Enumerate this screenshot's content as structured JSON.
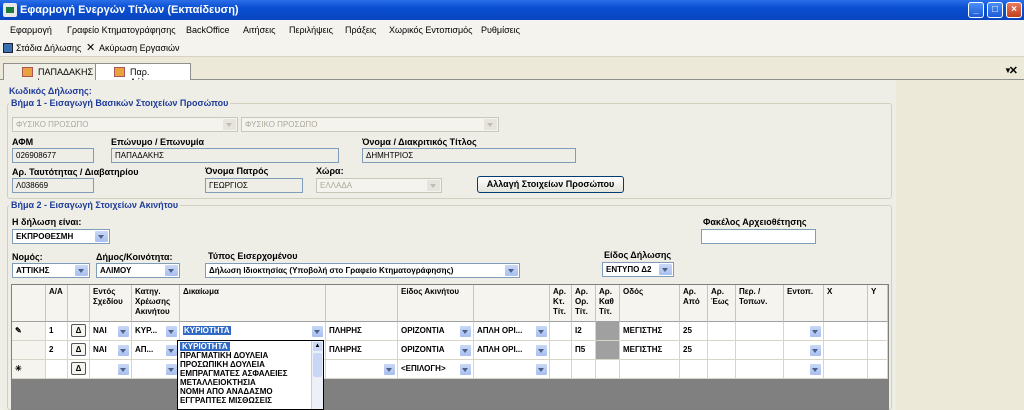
{
  "window": {
    "title": "Εφαρμογή Ενεργών Τίτλων (Εκπαίδευση)"
  },
  "menu": [
    "Εφαρμογή",
    "Γραφείο Κτηματογράφησης",
    "BackOffice",
    "Αιτήσεις",
    "Περιλήψεις",
    "Πράξεις",
    "Χωρικός Εντοπισμός",
    "Ρυθμίσεις"
  ],
  "toolbar": {
    "steps_label": "Στάδια Δήλωσης",
    "cancel_label": "Ακύρωση Εργασιών"
  },
  "tabs": [
    {
      "label": "ΠΑΠΑΔΑΚΗΣ \\"
    },
    {
      "label": "Παρ. Δήλωσης"
    }
  ],
  "form": {
    "code_label": "Κωδικός Δήλωσης:",
    "step1_title": "Βήμα 1 - Εισαγωγή Βασικών Στοιχείων Προσώπου",
    "person_type": "ΦΥΣΙΚΟ ΠΡΟΣΩΠΟ",
    "person_type2": "ΦΥΣΙΚΟ ΠΡΟΣΩΠΟ",
    "afm_label": "ΑΦΜ",
    "afm_value": "026908677",
    "surname_label": "Επώνυμο / Επωνυμία",
    "surname_value": "ΠΑΠΑΔΑΚΗΣ",
    "name_label": "Όνομα / Διακριτικός Τίτλος",
    "name_value": "ΔΗΜΗΤΡΙΟΣ",
    "id_label": "Αρ. Ταυτότητας / Διαβατηρίου",
    "id_value": "Λ038669",
    "father_label": "Όνομα Πατρός",
    "father_value": "ΓΕΩΡΓΙΟΣ",
    "country_label": "Χώρα:",
    "country_value": "ΕΛΛΑΔΑ",
    "change_button": "Αλλαγή Στοιχείων Προσώπου",
    "step2_title": "Βήμα 2 - Εισαγωγή Στοιχείων Ακινήτου",
    "decl_is_label": "Η δήλωση είναι:",
    "decl_is_value": "ΕΚΠΡΟΘΕΣΜΗ",
    "folder_label": "Φακέλος Αρχειοθέτησης",
    "folder_value": "",
    "prefecture_label": "Νομός:",
    "prefecture_value": "ΑΤΤΙΚΗΣ",
    "municipality_label": "Δήμος/Κοινότητα:",
    "municipality_value": "ΑΛΙΜΟΥ",
    "submission_label": "Τύπος Εισερχομένου",
    "submission_value": "Δήλωση Ιδιοκτησίας  (Υποβολή στο Γραφείο Κτηματογράφησης)",
    "form_type_label": "Είδος Δήλωσης",
    "form_type_value": "ΕΝΤΥΠΟ Δ2"
  },
  "grid": {
    "headers": [
      "Α/Α",
      "",
      "Εντός Σχεδίου",
      "Κατηγ. Χρέωσης Ακινήτου",
      "Δικαίωμα",
      "",
      "",
      "Είδος Ακινήτου",
      "",
      "Αρ. Κτ. Τίτ.",
      "Αρ. Ορ. Τίτ.",
      "Αρ. Καθ Τίτ.",
      "Οδός",
      "Αρ. Από",
      "Αρ. Έως",
      "Περ. / Τοπων.",
      "Εντοπ.",
      "X",
      "Y"
    ],
    "rows": [
      {
        "aa": "1",
        "btn": "Δ",
        "entos": "ΝΑΙ",
        "katig": "ΚΥΡ...",
        "dikaioma": "ΚΥΡΙΟΤΗΤΑ",
        "plires": "ΠΛΗΡΗΣ",
        "eidos": "ΟΡΙΖΟΝΤΙΑ",
        "eidos2": "ΑΠΛΗ ΟΡΙ...",
        "kt": "",
        "or": "Ι2",
        "odos": "ΜΕΓΙΣΤΗΣ",
        "apo": "25"
      },
      {
        "aa": "2",
        "btn": "Δ",
        "entos": "ΝΑΙ",
        "katig": "ΑΠ...",
        "dikaioma": "",
        "plires": "ΠΛΗΡΗΣ",
        "eidos": "ΟΡΙΖΟΝΤΙΑ",
        "eidos2": "ΑΠΛΗ ΟΡΙ...",
        "kt": "",
        "or": "Π5",
        "odos": "ΜΕΓΙΣΤΗΣ",
        "apo": "25"
      }
    ],
    "new_row": {
      "marker": "✳",
      "btn": "Δ",
      "eidos": "<ΕΠΙΛΟΓΗ>"
    },
    "row1_marker": "✎"
  },
  "dropdown": {
    "items": [
      "ΚΥΡΙΟΤΗΤΑ",
      "ΠΡΑΓΜΑΤΙΚΗ ΔΟΥΛΕΙΑ",
      "ΠΡΟΣΩΠΙΚΗ ΔΟΥΛΕΙΑ",
      "ΕΜΠΡΑΓΜΑΤΕΣ ΑΣΦΑΛΕΙΕΣ",
      "ΜΕΤΑΛΛΕΙΟΚΤΗΣΙΑ",
      "ΝΟΜΗ ΑΠΟ ΑΝΑΔΑΣΜΟ",
      "ΕΓΓΡΑΠΤΕΣ ΜΙΣΘΩΣΕΙΣ"
    ],
    "selected": "ΚΥΡΙΟΤΗΤΑ"
  }
}
